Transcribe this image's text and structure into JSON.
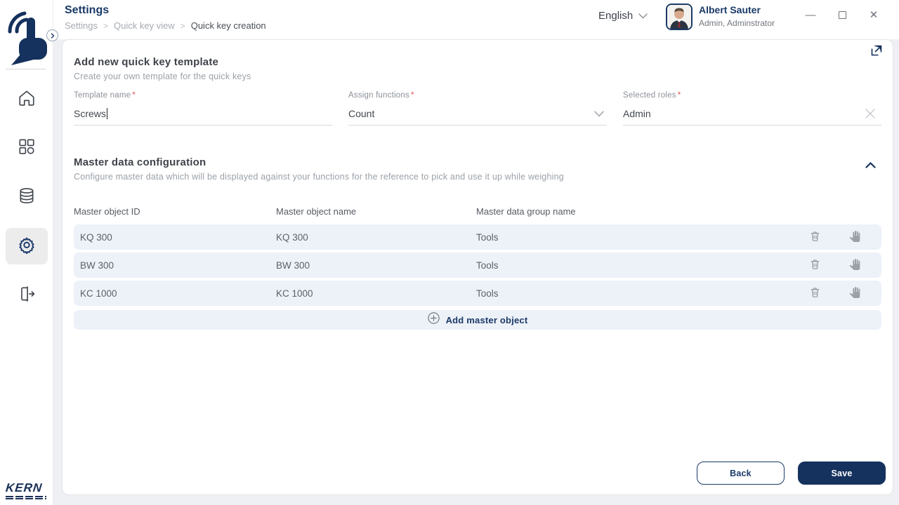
{
  "header": {
    "title": "Settings",
    "breadcrumb": {
      "items": [
        "Settings",
        "Quick key view",
        "Quick key creation"
      ],
      "separator": ">"
    },
    "language": "English",
    "user": {
      "name": "Albert Sauter",
      "role": "Admin, Adminstrator"
    },
    "window_controls": {
      "minimize": "—",
      "close": "✕"
    }
  },
  "sidebar": {
    "brand": "KERN",
    "items": [
      {
        "name": "home"
      },
      {
        "name": "dashboard"
      },
      {
        "name": "master-data"
      },
      {
        "name": "settings",
        "active": true
      },
      {
        "name": "logout"
      }
    ]
  },
  "quick_key_form": {
    "heading": "Add new quick key template",
    "subheading": "Create your own template for the quick keys",
    "required_marker": "*",
    "fields": {
      "template_name": {
        "label": "Template name",
        "value": "Screws"
      },
      "assign_functions": {
        "label": "Assign functions",
        "value": "Count"
      },
      "selected_roles": {
        "label": "Selected roles",
        "value": "Admin"
      }
    }
  },
  "master_data": {
    "heading": "Master data configuration",
    "subheading": "Configure master data which will be displayed against your functions for the reference to pick and use it up while weighing",
    "columns": [
      "Master object ID",
      "Master object name",
      "Master data group name"
    ],
    "rows": [
      {
        "id": "KQ 300",
        "name": "KQ 300",
        "group": "Tools"
      },
      {
        "id": "BW 300",
        "name": "BW 300",
        "group": "Tools"
      },
      {
        "id": "KC 1000",
        "name": "KC 1000",
        "group": "Tools"
      }
    ],
    "add_button": "Add master object"
  },
  "footer": {
    "back": "Back",
    "save": "Save"
  },
  "colors": {
    "navy": "#15315d",
    "row_bg": "#edf1f8",
    "required_red": "#e05252"
  }
}
